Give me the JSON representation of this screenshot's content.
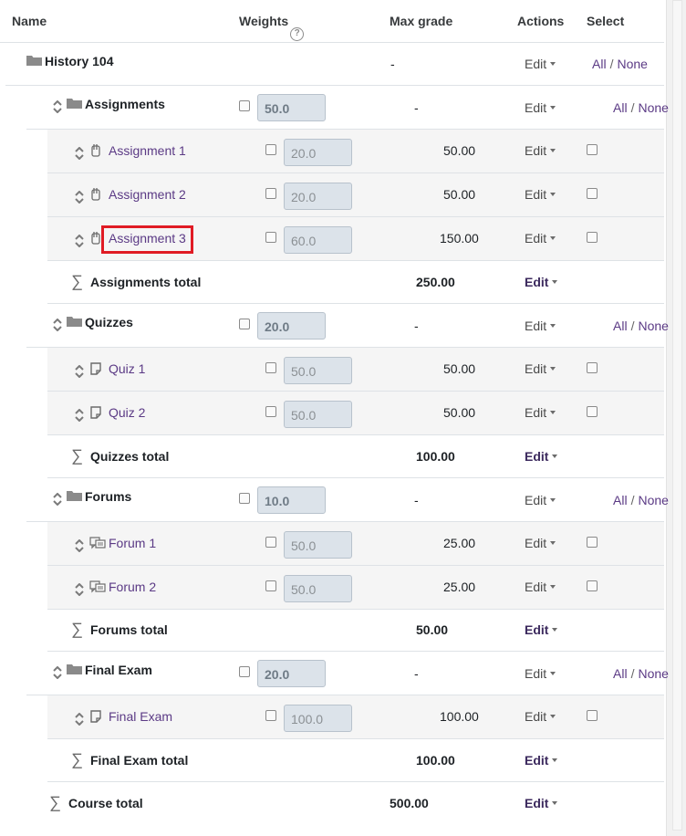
{
  "header": {
    "name": "Name",
    "weights": "Weights",
    "help": "?",
    "max_grade": "Max grade",
    "actions": "Actions",
    "select": "Select"
  },
  "course": {
    "name": "History 104",
    "max": "-",
    "edit": "Edit",
    "all": "All",
    "sep": "/",
    "none": "None"
  },
  "categories": [
    {
      "name": "Assignments",
      "weight": "50.0",
      "max": "-",
      "edit": "Edit",
      "all": "All",
      "sep": "/",
      "none": "None",
      "items": [
        {
          "name": "Assignment 1",
          "weight": "20.0",
          "max": "50.00",
          "edit": "Edit",
          "icon": "assignment-icon"
        },
        {
          "name": "Assignment 2",
          "weight": "20.0",
          "max": "50.00",
          "edit": "Edit",
          "icon": "assignment-icon"
        },
        {
          "name": "Assignment 3",
          "weight": "60.0",
          "max": "150.00",
          "edit": "Edit",
          "icon": "assignment-icon"
        }
      ],
      "total": {
        "name": "Assignments total",
        "max": "250.00",
        "edit": "Edit"
      }
    },
    {
      "name": "Quizzes",
      "weight": "20.0",
      "max": "-",
      "edit": "Edit",
      "all": "All",
      "sep": "/",
      "none": "None",
      "items": [
        {
          "name": "Quiz 1",
          "weight": "50.0",
          "max": "50.00",
          "edit": "Edit",
          "icon": "quiz-icon"
        },
        {
          "name": "Quiz 2",
          "weight": "50.0",
          "max": "50.00",
          "edit": "Edit",
          "icon": "quiz-icon"
        }
      ],
      "total": {
        "name": "Quizzes total",
        "max": "100.00",
        "edit": "Edit"
      }
    },
    {
      "name": "Forums",
      "weight": "10.0",
      "max": "-",
      "edit": "Edit",
      "all": "All",
      "sep": "/",
      "none": "None",
      "items": [
        {
          "name": "Forum 1",
          "weight": "50.0",
          "max": "25.00",
          "edit": "Edit",
          "icon": "forum-icon"
        },
        {
          "name": "Forum 2",
          "weight": "50.0",
          "max": "25.00",
          "edit": "Edit",
          "icon": "forum-icon"
        }
      ],
      "total": {
        "name": "Forums total",
        "max": "50.00",
        "edit": "Edit"
      }
    },
    {
      "name": "Final Exam",
      "weight": "20.0",
      "max": "-",
      "edit": "Edit",
      "all": "All",
      "sep": "/",
      "none": "None",
      "items": [
        {
          "name": "Final Exam",
          "weight": "100.0",
          "max": "100.00",
          "edit": "Edit",
          "icon": "quiz-icon"
        }
      ],
      "total": {
        "name": "Final Exam total",
        "max": "100.00",
        "edit": "Edit"
      }
    }
  ],
  "course_total": {
    "name": "Course total",
    "max": "500.00",
    "edit": "Edit"
  },
  "colors": {
    "accent": "#5b3a85",
    "highlight": "#e01b24",
    "row_shade": "#f5f5f5",
    "border": "#dee2e6"
  }
}
